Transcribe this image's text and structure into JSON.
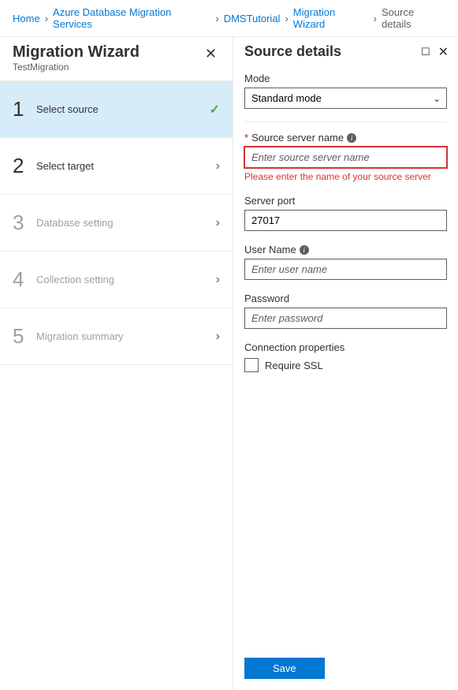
{
  "breadcrumb": {
    "items": [
      {
        "label": "Home"
      },
      {
        "label": "Azure Database Migration Services"
      },
      {
        "label": "DMSTutorial"
      },
      {
        "label": "Migration Wizard"
      }
    ],
    "current": "Source details"
  },
  "wizard": {
    "title": "Migration Wizard",
    "subtitle": "TestMigration",
    "steps": [
      {
        "num": "1",
        "label": "Select source"
      },
      {
        "num": "2",
        "label": "Select target"
      },
      {
        "num": "3",
        "label": "Database setting"
      },
      {
        "num": "4",
        "label": "Collection setting"
      },
      {
        "num": "5",
        "label": "Migration summary"
      }
    ]
  },
  "details": {
    "title": "Source details",
    "mode_label": "Mode",
    "mode_value": "Standard mode",
    "source_label": "Source server name",
    "source_placeholder": "Enter source server name",
    "source_error": "Please enter the name of your source server",
    "port_label": "Server port",
    "port_value": "27017",
    "user_label": "User Name",
    "user_placeholder": "Enter user name",
    "pass_label": "Password",
    "pass_placeholder": "Enter password",
    "conn_label": "Connection properties",
    "ssl_label": "Require SSL",
    "save_label": "Save"
  }
}
